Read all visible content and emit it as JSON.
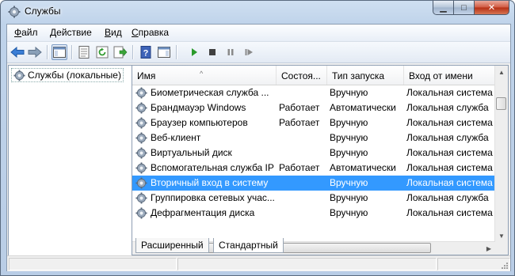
{
  "window": {
    "title": "Службы"
  },
  "menu": [
    {
      "key": "file",
      "pre": "",
      "ul": "Ф",
      "post": "айл"
    },
    {
      "key": "action",
      "pre": "",
      "ul": "Д",
      "post": "ействие"
    },
    {
      "key": "view",
      "pre": "",
      "ul": "В",
      "post": "ид"
    },
    {
      "key": "help",
      "pre": "",
      "ul": "С",
      "post": "правка"
    }
  ],
  "tree": {
    "root_label": "Службы (локальные)"
  },
  "columns": {
    "name": "Имя",
    "status": "Состоя...",
    "startup": "Тип запуска",
    "logon": "Вход от имени"
  },
  "services": [
    {
      "name": "Биометрическая служба ...",
      "status": "",
      "startup": "Вручную",
      "logon": "Локальная система"
    },
    {
      "name": "Брандмауэр Windows",
      "status": "Работает",
      "startup": "Автоматически",
      "logon": "Локальная служба"
    },
    {
      "name": "Браузер компьютеров",
      "status": "Работает",
      "startup": "Вручную",
      "logon": "Локальная система"
    },
    {
      "name": "Веб-клиент",
      "status": "",
      "startup": "Вручную",
      "logon": "Локальная служба"
    },
    {
      "name": "Виртуальный диск",
      "status": "",
      "startup": "Вручную",
      "logon": "Локальная система"
    },
    {
      "name": "Вспомогательная служба IP",
      "status": "Работает",
      "startup": "Автоматически",
      "logon": "Локальная система"
    },
    {
      "name": "Вторичный вход в систему",
      "status": "",
      "startup": "Вручную",
      "logon": "Локальная система",
      "selected": true
    },
    {
      "name": "Группировка сетевых учас...",
      "status": "",
      "startup": "Вручную",
      "logon": "Локальная служба"
    },
    {
      "name": "Дефрагментация диска",
      "status": "",
      "startup": "Вручную",
      "logon": "Локальная система"
    }
  ],
  "tabs": {
    "extended": "Расширенный",
    "standard": "Стандартный"
  },
  "colors": {
    "selection": "#3399ff",
    "play_icon": "#2a9a2a",
    "close_button": "#c8452c"
  }
}
